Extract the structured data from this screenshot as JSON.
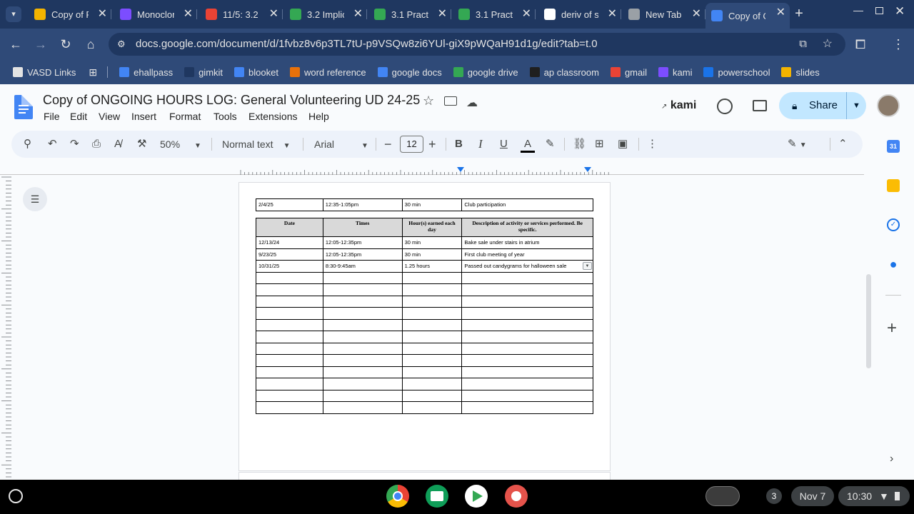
{
  "browser": {
    "tabs": [
      {
        "title": "Copy of P",
        "icon": "slides-icon",
        "color": "#f4b400"
      },
      {
        "title": "Monoclor",
        "icon": "shield-icon",
        "color": "#7c4dff"
      },
      {
        "title": "11/5: 3.2",
        "icon": "loading-icon",
        "color": "#ea4335"
      },
      {
        "title": "3.2 Implic",
        "icon": "drive-icon",
        "color": "#34a853"
      },
      {
        "title": "3.1 Pract",
        "icon": "drive-icon",
        "color": "#34a853"
      },
      {
        "title": "3.1 Pract",
        "icon": "drive-icon",
        "color": "#34a853"
      },
      {
        "title": "deriv of s",
        "icon": "google-icon",
        "color": "#ffffff"
      },
      {
        "title": "New Tab",
        "icon": "chrome-icon",
        "color": "#9aa0a6"
      },
      {
        "title": "Copy of C",
        "icon": "docs-icon",
        "color": "#4285f4",
        "active": true
      }
    ],
    "url": "docs.google.com/document/d/1fvbz8v6p3TL7tU-p9VSQw8zi6YUl-giX9pWQaH91d1g/edit?tab=t.0",
    "bookmarks": [
      {
        "label": "VASD Links",
        "icon": "folder-icon",
        "color": "#e3e3e3"
      },
      {
        "label": "ehallpass",
        "icon": "ehallpass-icon",
        "color": "#4285f4"
      },
      {
        "label": "gimkit",
        "icon": "gimkit-icon",
        "color": "#1f3760"
      },
      {
        "label": "blooket",
        "icon": "blooket-icon",
        "color": "#4285f4"
      },
      {
        "label": "word reference",
        "icon": "wordreference-icon",
        "color": "#e8710a"
      },
      {
        "label": "google docs",
        "icon": "docs-icon",
        "color": "#4285f4"
      },
      {
        "label": "google drive",
        "icon": "drive-icon",
        "color": "#34a853"
      },
      {
        "label": "ap classroom",
        "icon": "ap-icon",
        "color": "#1f1f1f"
      },
      {
        "label": "gmail",
        "icon": "gmail-icon",
        "color": "#ea4335"
      },
      {
        "label": "kami",
        "icon": "kami-icon",
        "color": "#7c4dff"
      },
      {
        "label": "powerschool",
        "icon": "powerschool-icon",
        "color": "#1a73e8"
      },
      {
        "label": "slides",
        "icon": "slides-icon",
        "color": "#f4b400"
      }
    ]
  },
  "doc": {
    "title": "Copy of ONGOING HOURS LOG: General Volunteering UD 24-25",
    "menu": [
      "File",
      "Edit",
      "View",
      "Insert",
      "Format",
      "Tools",
      "Extensions",
      "Help"
    ],
    "kami": "kami",
    "share": "Share",
    "toolbar": {
      "zoom": "50%",
      "style": "Normal text",
      "font": "Arial",
      "font_size": "12",
      "bold": "B",
      "italic": "I",
      "underline": "U"
    }
  },
  "table_top": [
    {
      "date": "2/4/25",
      "times": "12:35-1:05pm",
      "hours": "30 min",
      "desc": "Club participation"
    }
  ],
  "table": {
    "headers": [
      "Date",
      "Times",
      "Hour(s) earned each day",
      "Description of activity or services performed. Be specific."
    ],
    "rows": [
      [
        "12/13/24",
        "12:05-12:35pm",
        "30 min",
        "Bake sale under stairs in atrium"
      ],
      [
        "9/23/25",
        "12:05-12:35pm",
        "30 min",
        "First club meeting of year"
      ],
      [
        "10/31/25",
        "8:30-9:45am",
        "1.25 hours",
        "Passed out candygrams for halloween sale"
      ],
      [
        "",
        "",
        "",
        ""
      ],
      [
        "",
        "",
        "",
        ""
      ],
      [
        "",
        "",
        "",
        ""
      ],
      [
        "",
        "",
        "",
        ""
      ],
      [
        "",
        "",
        "",
        ""
      ],
      [
        "",
        "",
        "",
        ""
      ],
      [
        "",
        "",
        "",
        ""
      ],
      [
        "",
        "",
        "",
        ""
      ],
      [
        "",
        "",
        "",
        ""
      ],
      [
        "",
        "",
        "",
        ""
      ],
      [
        "",
        "",
        "",
        ""
      ],
      [
        "",
        "",
        "",
        ""
      ]
    ]
  },
  "shelf": {
    "notifications": "3",
    "date": "Nov 7",
    "time": "10:30"
  }
}
